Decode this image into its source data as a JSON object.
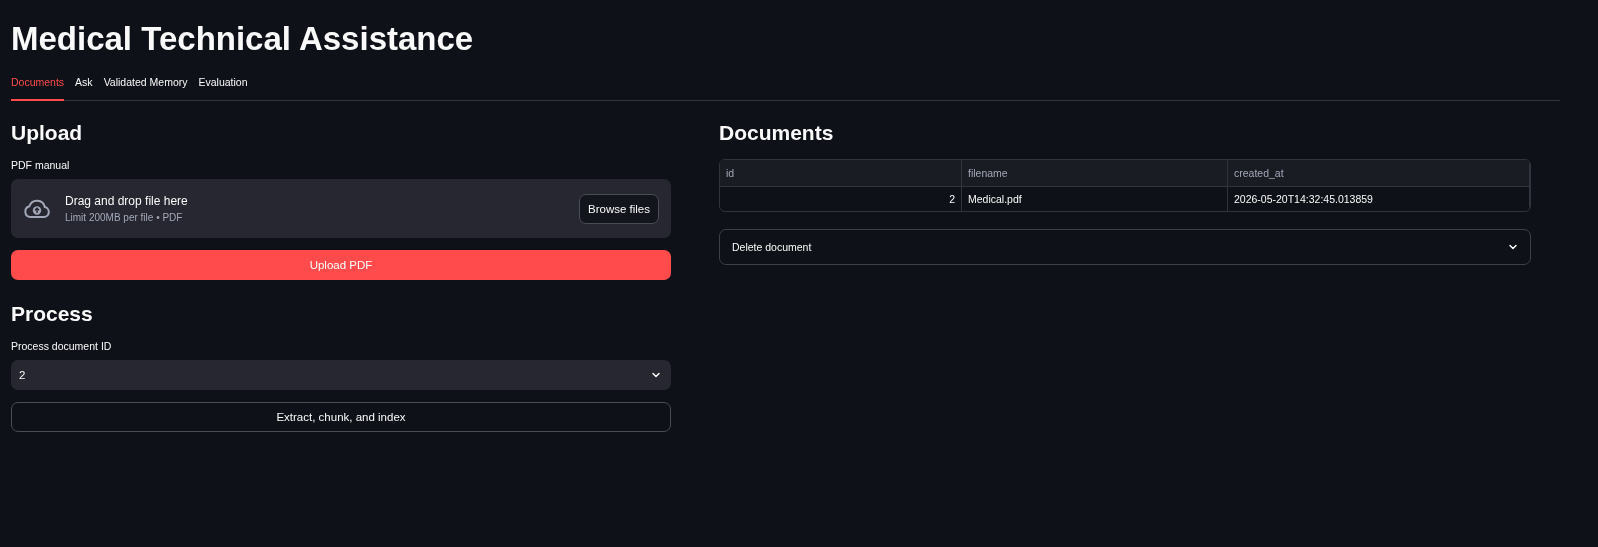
{
  "title": "Medical Technical Assistance",
  "tabs": [
    {
      "label": "Documents",
      "selected": true
    },
    {
      "label": "Ask",
      "selected": false
    },
    {
      "label": "Validated Memory",
      "selected": false
    },
    {
      "label": "Evaluation",
      "selected": false
    }
  ],
  "upload": {
    "heading": "Upload",
    "label": "PDF manual",
    "dropzone": {
      "title": "Drag and drop file here",
      "hint": "Limit 200MB per file • PDF",
      "button": "Browse files"
    },
    "submit": "Upload PDF"
  },
  "process": {
    "heading": "Process",
    "label": "Process document ID",
    "select": {
      "value": "2"
    },
    "button": "Extract, chunk, and index"
  },
  "documents": {
    "heading": "Documents",
    "table": {
      "columns": [
        "id",
        "filename",
        "created_at"
      ],
      "rows": [
        [
          "2",
          "Medical.pdf",
          "2026-05-20T14:32:45.013859"
        ]
      ]
    },
    "expander": {
      "label": "Delete document",
      "expanded": false
    }
  }
}
